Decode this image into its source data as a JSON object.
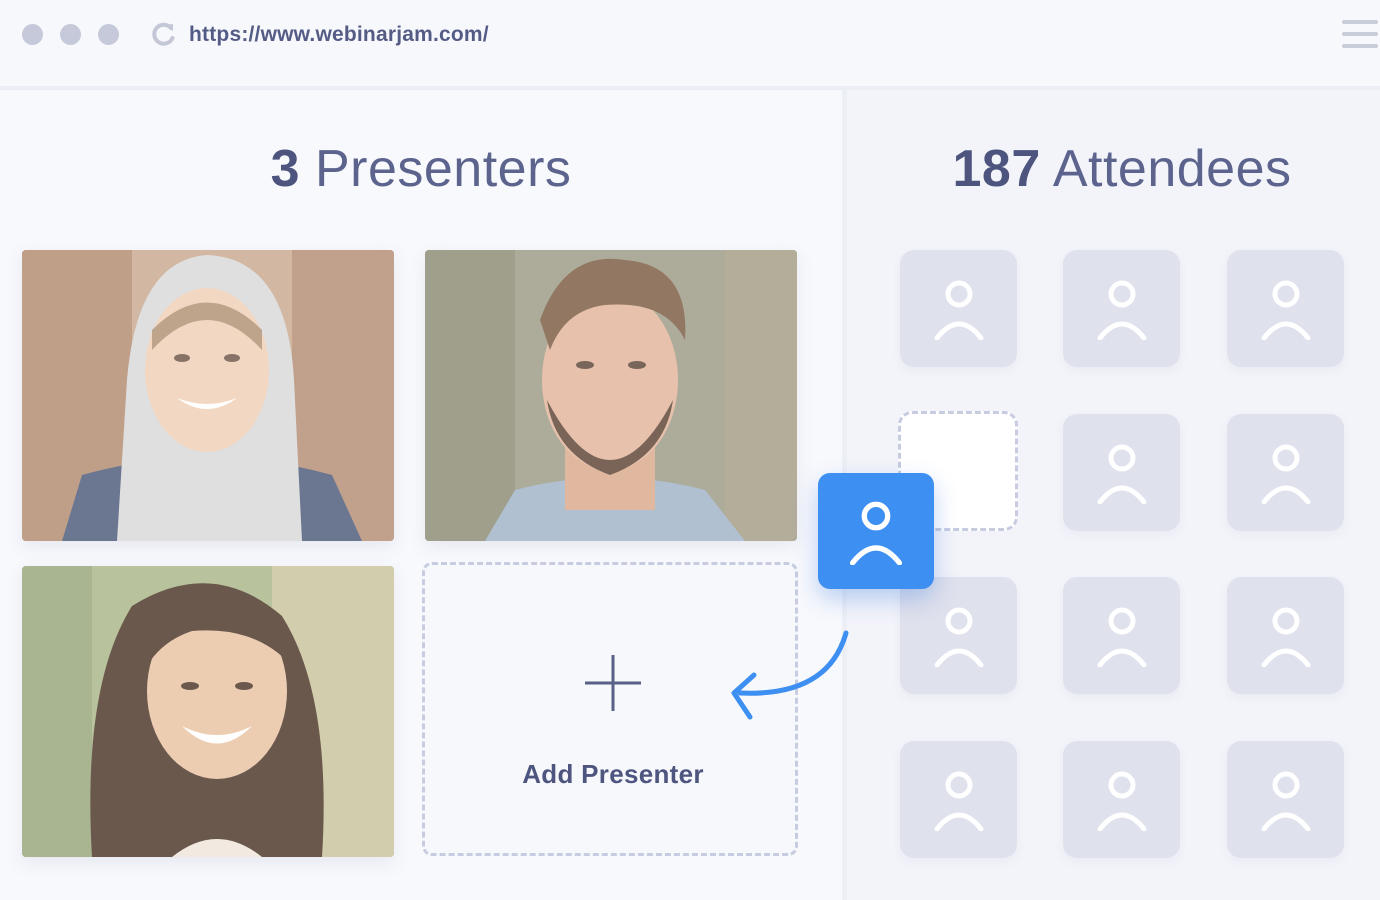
{
  "browser": {
    "url": "https://www.webinarjam.com/",
    "icons": [
      "window-dot-icon",
      "reload-icon",
      "hamburger-menu-icon"
    ]
  },
  "presenters": {
    "count": "3",
    "label": "Presenters",
    "add_label": "Add Presenter"
  },
  "attendees": {
    "count": "187",
    "label": "Attendees",
    "slots_filled": 11,
    "slots_empty": 1
  },
  "colors": {
    "accent": "#3d8ff2",
    "heading": "#5c648d",
    "tile": "#dfe1ec",
    "background": "#f8f9fd"
  }
}
